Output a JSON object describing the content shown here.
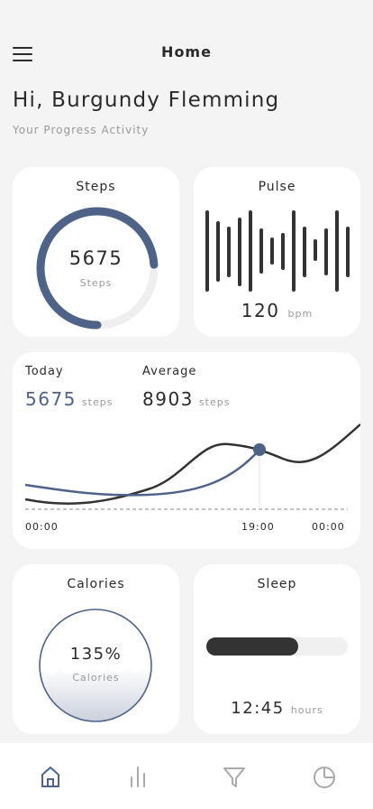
{
  "header": {
    "title": "Home"
  },
  "greeting": {
    "name": "Hi, Burgundy Flemming",
    "subtitle": "Your Progress Activity"
  },
  "steps": {
    "title": "Steps",
    "value": "5675",
    "unit": "Steps",
    "progress": 0.74
  },
  "pulse": {
    "title": "Pulse",
    "value": "120",
    "unit": "bpm"
  },
  "activity": {
    "today_label": "Today",
    "today_value": "5675",
    "today_unit": "steps",
    "average_label": "Average",
    "average_value": "8903",
    "average_unit": "steps",
    "ticks": [
      "00:00",
      "19:00",
      "00:00"
    ]
  },
  "calories": {
    "title": "Calories",
    "value": "135%",
    "unit": "Calories"
  },
  "sleep": {
    "title": "Sleep",
    "value": "12:45",
    "unit": "hours",
    "progress": 0.65
  },
  "colors": {
    "accent": "#4e6387",
    "dark": "#2b2b2b",
    "muted": "#9a9a9a"
  },
  "nav": {
    "items": [
      "home-icon",
      "bar-chart-icon",
      "filter-icon",
      "pie-chart-icon"
    ],
    "active": 0
  }
}
